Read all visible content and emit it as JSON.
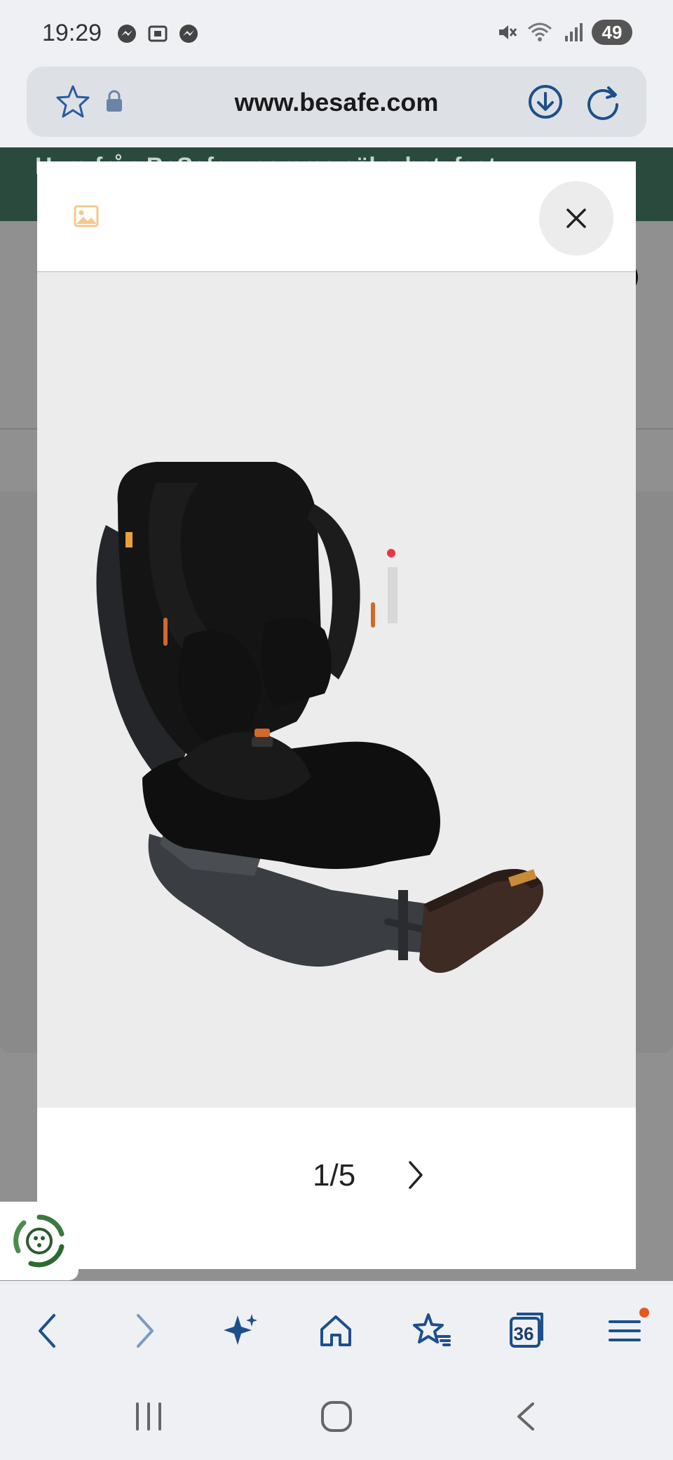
{
  "status_bar": {
    "time": "19:29",
    "battery": "49"
  },
  "browser": {
    "url": "www.besafe.com"
  },
  "background_page": {
    "banner_text": "Hyra från BeSafe – samma säkerhet, fast"
  },
  "modal": {
    "pager_current": "1",
    "pager_total": "5",
    "pager_text": "1/5",
    "image_alt": "BeSafe iZi Kid car seat, black",
    "accent_color": "#f3c98b"
  },
  "toolbar": {
    "tab_count": "36"
  },
  "icons": {
    "status_left": [
      "messenger-icon",
      "screenshot-icon",
      "messenger-icon"
    ],
    "status_right": [
      "mute-icon",
      "wifi-icon",
      "signal-icon",
      "battery-icon"
    ],
    "toolbar": [
      "back-icon",
      "forward-icon",
      "sparkle-icon",
      "home-icon",
      "bookmarks-icon",
      "tabs-icon",
      "menu-icon"
    ],
    "navbar": [
      "recents-icon",
      "home-nav-icon",
      "back-nav-icon"
    ]
  }
}
